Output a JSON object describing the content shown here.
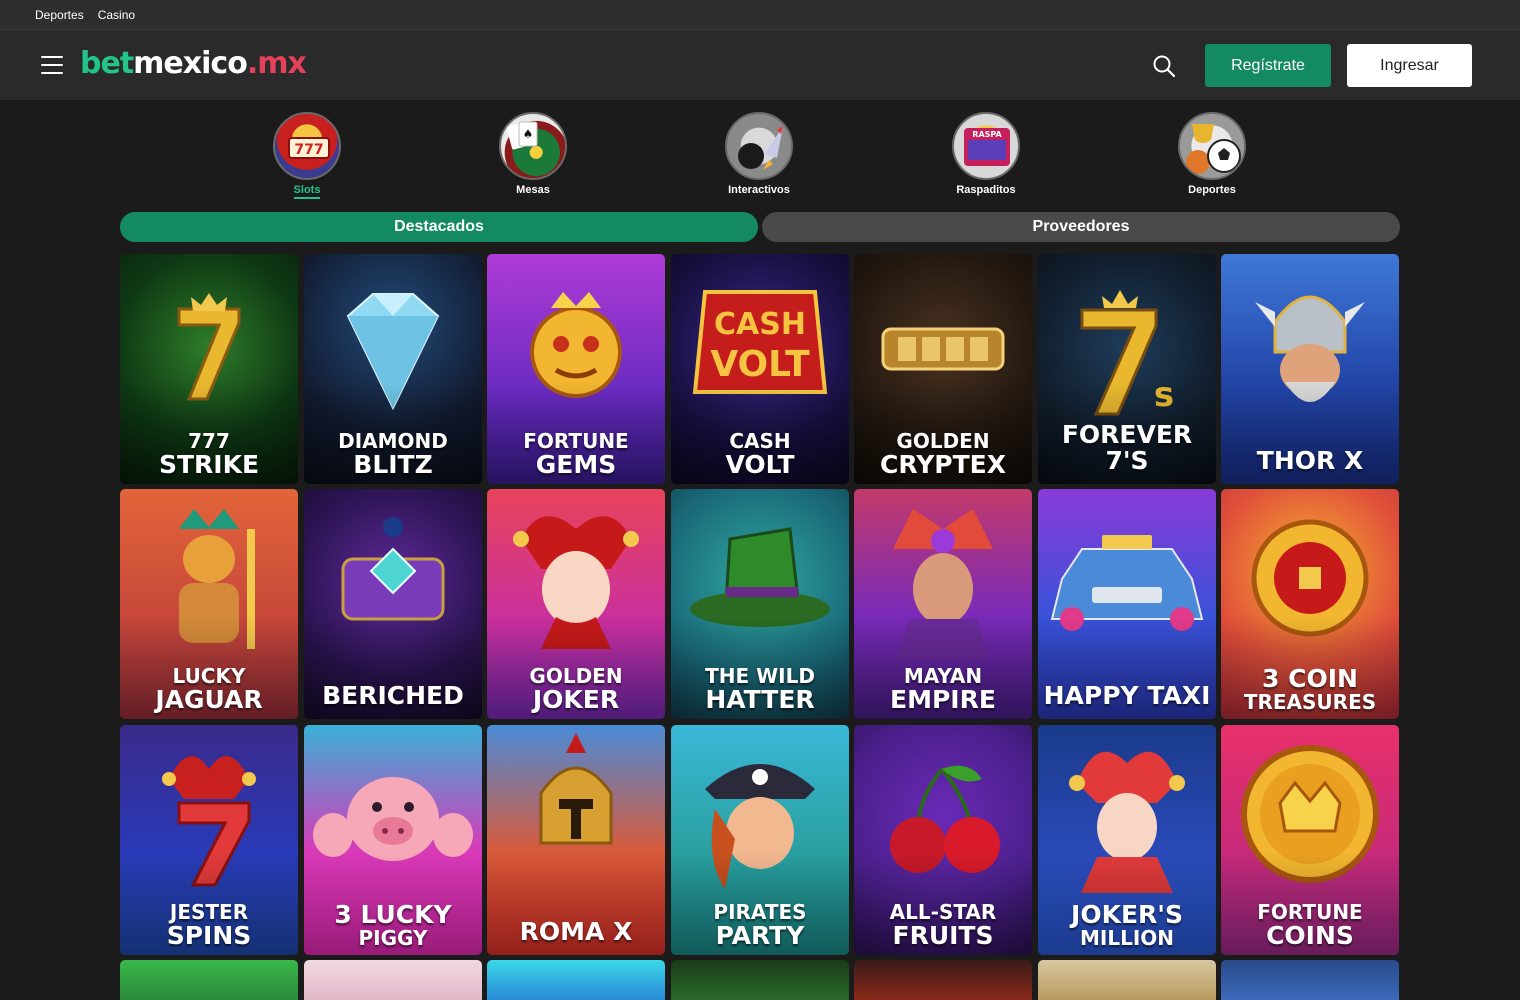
{
  "topbar": {
    "links": [
      "Deportes",
      "Casino"
    ]
  },
  "header": {
    "logo": {
      "bet": "bet",
      "mexico": "mexico",
      "dot": ".",
      "mx": "mx"
    },
    "register_label": "Regístrate",
    "login_label": "Ingresar"
  },
  "categories": [
    {
      "label": "Slots",
      "active": true,
      "icon": "slot-machine-icon"
    },
    {
      "label": "Mesas",
      "active": false,
      "icon": "roulette-icon"
    },
    {
      "label": "Interactivos",
      "active": false,
      "icon": "rocket-bomb-icon"
    },
    {
      "label": "Raspaditos",
      "active": false,
      "icon": "scratch-card-icon"
    },
    {
      "label": "Deportes",
      "active": false,
      "icon": "sports-ball-icon"
    }
  ],
  "tabs": {
    "featured": "Destacados",
    "providers": "Proveedores"
  },
  "games": [
    {
      "l1": "777",
      "l2": "STRIKE"
    },
    {
      "l1": "DIAMOND",
      "l2": "BLITZ"
    },
    {
      "l1": "FORTUNE",
      "l2": "GEMS"
    },
    {
      "l1": "CASH",
      "l2": "VOLT"
    },
    {
      "l1": "GOLDEN",
      "l2": "CRYPTEX"
    },
    {
      "l1": "",
      "l2": "FOREVER 7'S"
    },
    {
      "l1": "",
      "l2": "THOR X"
    },
    {
      "l1": "LUCKY",
      "l2": "JAGUAR"
    },
    {
      "l1": "",
      "l2": "BERICHED"
    },
    {
      "l1": "GOLDEN",
      "l2": "JOKER"
    },
    {
      "l1": "THE WILD",
      "l2": "HATTER"
    },
    {
      "l1": "MAYAN",
      "l2": "EMPIRE"
    },
    {
      "l1": "",
      "l2": "HAPPY TAXI"
    },
    {
      "l1": "3 COIN",
      "l2": "TREASURES"
    },
    {
      "l1": "JESTER",
      "l2": "SPINS"
    },
    {
      "l1": "3 LUCKY",
      "l2": "PIGGY"
    },
    {
      "l1": "",
      "l2": "ROMA X"
    },
    {
      "l1": "PIRATES",
      "l2": "PARTY"
    },
    {
      "l1": "ALL-STAR",
      "l2": "FRUITS"
    },
    {
      "l1": "JOKER'S",
      "l2": "MILLION"
    },
    {
      "l1": "FORTUNE",
      "l2": "COINS"
    }
  ]
}
